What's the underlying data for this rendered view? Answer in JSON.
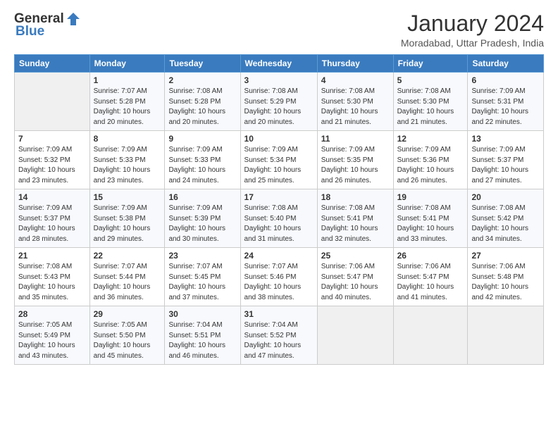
{
  "header": {
    "logo_general": "General",
    "logo_blue": "Blue",
    "month_title": "January 2024",
    "location": "Moradabad, Uttar Pradesh, India"
  },
  "days_of_week": [
    "Sunday",
    "Monday",
    "Tuesday",
    "Wednesday",
    "Thursday",
    "Friday",
    "Saturday"
  ],
  "weeks": [
    [
      {
        "day": "",
        "info": ""
      },
      {
        "day": "1",
        "info": "Sunrise: 7:07 AM\nSunset: 5:28 PM\nDaylight: 10 hours\nand 20 minutes."
      },
      {
        "day": "2",
        "info": "Sunrise: 7:08 AM\nSunset: 5:28 PM\nDaylight: 10 hours\nand 20 minutes."
      },
      {
        "day": "3",
        "info": "Sunrise: 7:08 AM\nSunset: 5:29 PM\nDaylight: 10 hours\nand 20 minutes."
      },
      {
        "day": "4",
        "info": "Sunrise: 7:08 AM\nSunset: 5:30 PM\nDaylight: 10 hours\nand 21 minutes."
      },
      {
        "day": "5",
        "info": "Sunrise: 7:08 AM\nSunset: 5:30 PM\nDaylight: 10 hours\nand 21 minutes."
      },
      {
        "day": "6",
        "info": "Sunrise: 7:09 AM\nSunset: 5:31 PM\nDaylight: 10 hours\nand 22 minutes."
      }
    ],
    [
      {
        "day": "7",
        "info": "Sunrise: 7:09 AM\nSunset: 5:32 PM\nDaylight: 10 hours\nand 23 minutes."
      },
      {
        "day": "8",
        "info": "Sunrise: 7:09 AM\nSunset: 5:33 PM\nDaylight: 10 hours\nand 23 minutes."
      },
      {
        "day": "9",
        "info": "Sunrise: 7:09 AM\nSunset: 5:33 PM\nDaylight: 10 hours\nand 24 minutes."
      },
      {
        "day": "10",
        "info": "Sunrise: 7:09 AM\nSunset: 5:34 PM\nDaylight: 10 hours\nand 25 minutes."
      },
      {
        "day": "11",
        "info": "Sunrise: 7:09 AM\nSunset: 5:35 PM\nDaylight: 10 hours\nand 26 minutes."
      },
      {
        "day": "12",
        "info": "Sunrise: 7:09 AM\nSunset: 5:36 PM\nDaylight: 10 hours\nand 26 minutes."
      },
      {
        "day": "13",
        "info": "Sunrise: 7:09 AM\nSunset: 5:37 PM\nDaylight: 10 hours\nand 27 minutes."
      }
    ],
    [
      {
        "day": "14",
        "info": "Sunrise: 7:09 AM\nSunset: 5:37 PM\nDaylight: 10 hours\nand 28 minutes."
      },
      {
        "day": "15",
        "info": "Sunrise: 7:09 AM\nSunset: 5:38 PM\nDaylight: 10 hours\nand 29 minutes."
      },
      {
        "day": "16",
        "info": "Sunrise: 7:09 AM\nSunset: 5:39 PM\nDaylight: 10 hours\nand 30 minutes."
      },
      {
        "day": "17",
        "info": "Sunrise: 7:08 AM\nSunset: 5:40 PM\nDaylight: 10 hours\nand 31 minutes."
      },
      {
        "day": "18",
        "info": "Sunrise: 7:08 AM\nSunset: 5:41 PM\nDaylight: 10 hours\nand 32 minutes."
      },
      {
        "day": "19",
        "info": "Sunrise: 7:08 AM\nSunset: 5:41 PM\nDaylight: 10 hours\nand 33 minutes."
      },
      {
        "day": "20",
        "info": "Sunrise: 7:08 AM\nSunset: 5:42 PM\nDaylight: 10 hours\nand 34 minutes."
      }
    ],
    [
      {
        "day": "21",
        "info": "Sunrise: 7:08 AM\nSunset: 5:43 PM\nDaylight: 10 hours\nand 35 minutes."
      },
      {
        "day": "22",
        "info": "Sunrise: 7:07 AM\nSunset: 5:44 PM\nDaylight: 10 hours\nand 36 minutes."
      },
      {
        "day": "23",
        "info": "Sunrise: 7:07 AM\nSunset: 5:45 PM\nDaylight: 10 hours\nand 37 minutes."
      },
      {
        "day": "24",
        "info": "Sunrise: 7:07 AM\nSunset: 5:46 PM\nDaylight: 10 hours\nand 38 minutes."
      },
      {
        "day": "25",
        "info": "Sunrise: 7:06 AM\nSunset: 5:47 PM\nDaylight: 10 hours\nand 40 minutes."
      },
      {
        "day": "26",
        "info": "Sunrise: 7:06 AM\nSunset: 5:47 PM\nDaylight: 10 hours\nand 41 minutes."
      },
      {
        "day": "27",
        "info": "Sunrise: 7:06 AM\nSunset: 5:48 PM\nDaylight: 10 hours\nand 42 minutes."
      }
    ],
    [
      {
        "day": "28",
        "info": "Sunrise: 7:05 AM\nSunset: 5:49 PM\nDaylight: 10 hours\nand 43 minutes."
      },
      {
        "day": "29",
        "info": "Sunrise: 7:05 AM\nSunset: 5:50 PM\nDaylight: 10 hours\nand 45 minutes."
      },
      {
        "day": "30",
        "info": "Sunrise: 7:04 AM\nSunset: 5:51 PM\nDaylight: 10 hours\nand 46 minutes."
      },
      {
        "day": "31",
        "info": "Sunrise: 7:04 AM\nSunset: 5:52 PM\nDaylight: 10 hours\nand 47 minutes."
      },
      {
        "day": "",
        "info": ""
      },
      {
        "day": "",
        "info": ""
      },
      {
        "day": "",
        "info": ""
      }
    ]
  ]
}
